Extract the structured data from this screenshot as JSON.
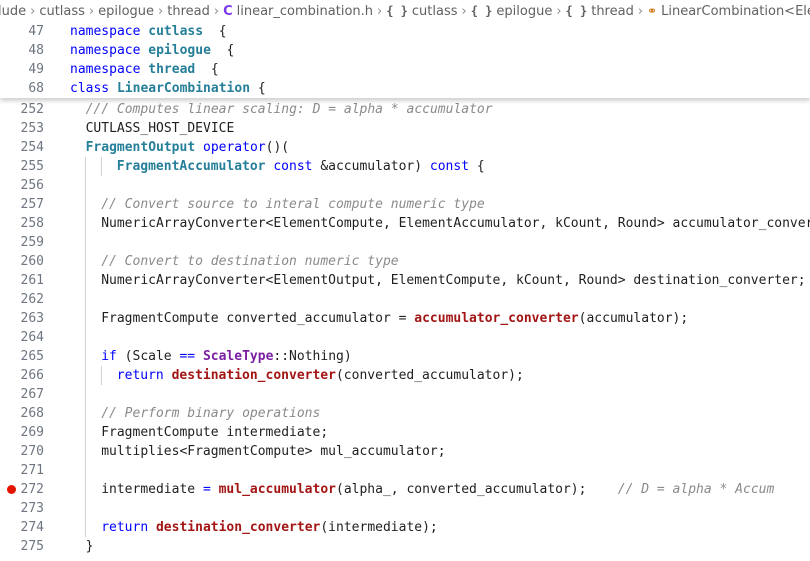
{
  "breadcrumb": {
    "items": [
      {
        "label": "lude",
        "icon": ""
      },
      {
        "label": "cutlass",
        "icon": ""
      },
      {
        "label": "epilogue",
        "icon": ""
      },
      {
        "label": "thread",
        "icon": ""
      },
      {
        "label": "linear_combination.h",
        "icon": "C"
      },
      {
        "label": "cutlass",
        "icon": "{ }"
      },
      {
        "label": "epilogue",
        "icon": "{ }"
      },
      {
        "label": "thread",
        "icon": "{ }"
      },
      {
        "label": "LinearCombination<ElementOut",
        "icon": "class-icon"
      }
    ],
    "separator": ">"
  },
  "sticky_scroll": [
    {
      "num": "47",
      "tokens": [
        [
          "kw",
          "namespace "
        ],
        [
          "ty",
          "cutlass"
        ],
        [
          "",
          "  {"
        ]
      ]
    },
    {
      "num": "48",
      "tokens": [
        [
          "kw",
          "namespace "
        ],
        [
          "ty",
          "epilogue"
        ],
        [
          "",
          "  {"
        ]
      ]
    },
    {
      "num": "49",
      "tokens": [
        [
          "kw",
          "namespace "
        ],
        [
          "ty",
          "thread"
        ],
        [
          "",
          "  {"
        ]
      ]
    },
    {
      "num": "68",
      "tokens": [
        [
          "kw",
          "class "
        ],
        [
          "ty",
          "LinearCombination"
        ],
        [
          "",
          " {"
        ]
      ]
    }
  ],
  "code_lines": [
    {
      "num": "252",
      "indent": 1,
      "tokens": [
        [
          "cm",
          "/// Computes linear scaling: D = alpha * accumulator"
        ]
      ]
    },
    {
      "num": "253",
      "indent": 1,
      "tokens": [
        [
          "",
          "CUTLASS_HOST_DEVICE"
        ]
      ]
    },
    {
      "num": "254",
      "indent": 1,
      "tokens": [
        [
          "ty",
          "FragmentOutput "
        ],
        [
          "kw",
          "operator"
        ],
        [
          "",
          "()("
        ]
      ]
    },
    {
      "num": "255",
      "indent": 3,
      "tokens": [
        [
          "ty",
          "FragmentAccumulator "
        ],
        [
          "kw",
          "const "
        ],
        [
          "",
          "&accumulator) "
        ],
        [
          "kw",
          "const"
        ],
        [
          "",
          " {"
        ]
      ]
    },
    {
      "num": "256",
      "indent": 0,
      "tokens": []
    },
    {
      "num": "257",
      "indent": 2,
      "tokens": [
        [
          "cm",
          "// Convert source to interal compute numeric type"
        ]
      ]
    },
    {
      "num": "258",
      "indent": 2,
      "tokens": [
        [
          "",
          "NumericArrayConverter<ElementCompute, ElementAccumulator, kCount, Round> accumulator_converter;"
        ]
      ]
    },
    {
      "num": "259",
      "indent": 0,
      "tokens": []
    },
    {
      "num": "260",
      "indent": 2,
      "tokens": [
        [
          "cm",
          "// Convert to destination numeric type"
        ]
      ]
    },
    {
      "num": "261",
      "indent": 2,
      "tokens": [
        [
          "",
          "NumericArrayConverter<ElementOutput, ElementCompute, kCount, Round> destination_converter;"
        ]
      ]
    },
    {
      "num": "262",
      "indent": 0,
      "tokens": []
    },
    {
      "num": "263",
      "indent": 2,
      "tokens": [
        [
          "",
          "FragmentCompute converted_accumulator = "
        ],
        [
          "fn",
          "accumulator_converter"
        ],
        [
          "",
          "(accumulator);"
        ]
      ]
    },
    {
      "num": "264",
      "indent": 0,
      "tokens": []
    },
    {
      "num": "265",
      "indent": 2,
      "tokens": [
        [
          "kw",
          "if "
        ],
        [
          "",
          "(Scale "
        ],
        [
          "op",
          "=="
        ],
        [
          "",
          " "
        ],
        [
          "tp",
          "ScaleType"
        ],
        [
          "",
          "::Nothing)"
        ]
      ]
    },
    {
      "num": "266",
      "indent": 3,
      "tokens": [
        [
          "kw",
          "return "
        ],
        [
          "fn",
          "destination_converter"
        ],
        [
          "",
          "(converted_accumulator);"
        ]
      ]
    },
    {
      "num": "267",
      "indent": 0,
      "tokens": []
    },
    {
      "num": "268",
      "indent": 2,
      "tokens": [
        [
          "cm",
          "// Perform binary operations"
        ]
      ]
    },
    {
      "num": "269",
      "indent": 2,
      "tokens": [
        [
          "",
          "FragmentCompute intermediate;"
        ]
      ]
    },
    {
      "num": "270",
      "indent": 2,
      "tokens": [
        [
          "",
          "multiplies<FragmentCompute> mul_accumulator;"
        ]
      ]
    },
    {
      "num": "271",
      "indent": 0,
      "tokens": []
    },
    {
      "num": "272",
      "indent": 2,
      "breakpoint": true,
      "tokens": [
        [
          "",
          "intermediate "
        ],
        [
          "op",
          "="
        ],
        [
          "",
          " "
        ],
        [
          "fn",
          "mul_accumulator"
        ],
        [
          "",
          "(alpha_, converted_accumulator);    "
        ],
        [
          "cm",
          "// D = alpha * Accum"
        ]
      ]
    },
    {
      "num": "273",
      "indent": 0,
      "tokens": []
    },
    {
      "num": "274",
      "indent": 2,
      "tokens": [
        [
          "kw",
          "return "
        ],
        [
          "fn",
          "destination_converter"
        ],
        [
          "",
          "(intermediate);"
        ]
      ]
    },
    {
      "num": "275",
      "indent": 1,
      "tokens": [
        [
          "",
          "}"
        ]
      ]
    }
  ],
  "colors": {
    "keyword": "#0000ff",
    "type": "#267f99",
    "function": "#a31515",
    "comment": "#8a8a8a",
    "breakpoint": "#e51400"
  }
}
